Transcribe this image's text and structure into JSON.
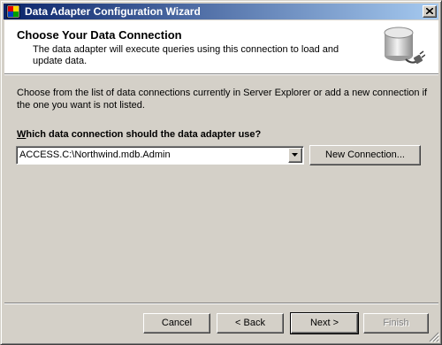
{
  "window": {
    "title": "Data Adapter Configuration Wizard"
  },
  "header": {
    "title": "Choose Your Data Connection",
    "description": "The data adapter will execute queries using this connection to load and update data."
  },
  "content": {
    "instructions": "Choose from the list of data connections currently in Server Explorer or add a new connection if the one you want is not listed.",
    "question_prefix": "W",
    "question_rest": "hich data connection should the data adapter use?",
    "connection": {
      "selected": "ACCESS.C:\\Northwind.mdb.Admin"
    },
    "new_connection_label": "New Connection..."
  },
  "footer": {
    "cancel": "Cancel",
    "back": "< Back",
    "next": "Next >",
    "finish": "Finish"
  },
  "icons": {
    "title": "wizard-app-icon",
    "close": "close-icon",
    "header": "database-plug-icon",
    "dropdown": "chevron-down-icon",
    "grip": "resize-grip-icon"
  }
}
